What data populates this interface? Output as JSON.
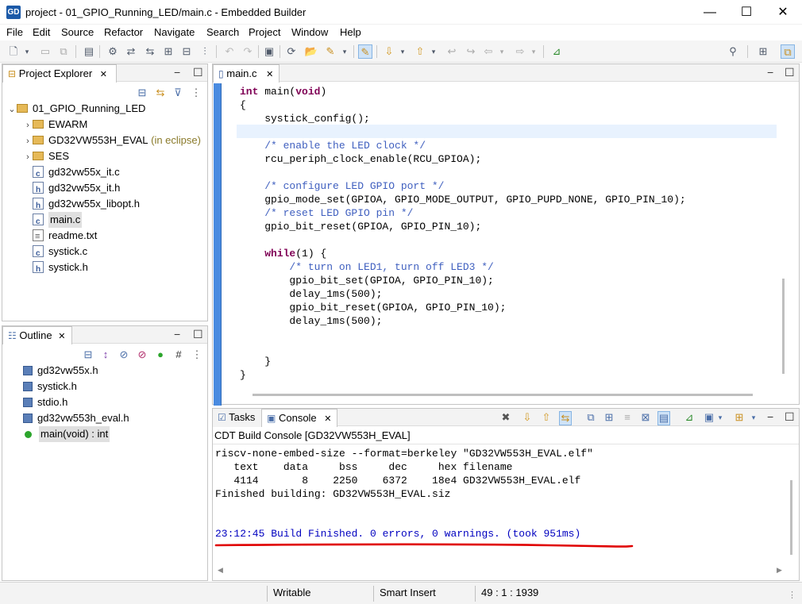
{
  "window": {
    "app_icon_text": "GD",
    "title": "project - 01_GPIO_Running_LED/main.c - Embedded Builder",
    "minimize": "—",
    "maximize": "☐",
    "close": "✕"
  },
  "menu": [
    "File",
    "Edit",
    "Source",
    "Refactor",
    "Navigate",
    "Search",
    "Project",
    "Window",
    "Help"
  ],
  "project_explorer": {
    "title": "Project Explorer",
    "tree": [
      {
        "label": "01_GPIO_Running_LED",
        "type": "project",
        "indent": 0,
        "expanded": true
      },
      {
        "label": "EWARM",
        "type": "folder",
        "indent": 1
      },
      {
        "label": "GD32VW553H_EVAL",
        "suffix": "(in eclipse)",
        "type": "folder",
        "indent": 1
      },
      {
        "label": "SES",
        "type": "folder",
        "indent": 1
      },
      {
        "label": "gd32vw55x_it.c",
        "type": "c",
        "indent": 1
      },
      {
        "label": "gd32vw55x_it.h",
        "type": "h",
        "indent": 1
      },
      {
        "label": "gd32vw55x_libopt.h",
        "type": "h",
        "indent": 1
      },
      {
        "label": "main.c",
        "type": "c",
        "indent": 1,
        "selected": true
      },
      {
        "label": "readme.txt",
        "type": "txt",
        "indent": 1
      },
      {
        "label": "systick.c",
        "type": "c",
        "indent": 1
      },
      {
        "label": "systick.h",
        "type": "h",
        "indent": 1
      }
    ]
  },
  "outline": {
    "title": "Outline",
    "items": [
      {
        "label": "gd32vw55x.h",
        "type": "include"
      },
      {
        "label": "systick.h",
        "type": "include"
      },
      {
        "label": "stdio.h",
        "type": "include"
      },
      {
        "label": "gd32vw553h_eval.h",
        "type": "include"
      },
      {
        "label": "main(void) : int",
        "type": "function",
        "selected": true
      }
    ]
  },
  "editor": {
    "tab": "main.c",
    "lines": [
      [
        {
          "t": "int",
          "c": "kw"
        },
        {
          "t": " main("
        },
        {
          "t": "void",
          "c": "kw"
        },
        {
          "t": ")"
        }
      ],
      [
        {
          "t": "{"
        }
      ],
      [
        {
          "t": "    systick_config();"
        }
      ],
      [
        {
          "t": ""
        }
      ],
      [
        {
          "t": "    /* enable the LED clock */",
          "c": "cm"
        }
      ],
      [
        {
          "t": "    rcu_periph_clock_enable(RCU_GPIOA);"
        }
      ],
      [
        {
          "t": ""
        }
      ],
      [
        {
          "t": "    /* configure LED GPIO port */",
          "c": "cm"
        }
      ],
      [
        {
          "t": "    gpio_mode_set(GPIOA, GPIO_MODE_OUTPUT, GPIO_PUPD_NONE, GPIO_PIN_10);"
        }
      ],
      [
        {
          "t": "    /* reset LED GPIO pin */",
          "c": "cm"
        }
      ],
      [
        {
          "t": "    gpio_bit_reset(GPIOA, GPIO_PIN_10);"
        }
      ],
      [
        {
          "t": ""
        }
      ],
      [
        {
          "t": "    "
        },
        {
          "t": "while",
          "c": "kw"
        },
        {
          "t": "(1) {"
        }
      ],
      [
        {
          "t": "        /* turn on LED1, turn off LED3 */",
          "c": "cm"
        }
      ],
      [
        {
          "t": "        gpio_bit_set(GPIOA, GPIO_PIN_10);"
        }
      ],
      [
        {
          "t": "        delay_1ms(500);"
        }
      ],
      [
        {
          "t": "        gpio_bit_reset(GPIOA, GPIO_PIN_10);"
        }
      ],
      [
        {
          "t": "        delay_1ms(500);"
        }
      ],
      [
        {
          "t": ""
        }
      ],
      [
        {
          "t": ""
        }
      ],
      [
        {
          "t": "    }"
        }
      ],
      [
        {
          "t": "}"
        }
      ]
    ]
  },
  "console": {
    "tabs": [
      "Tasks",
      "Console"
    ],
    "header": "CDT Build Console [GD32VW553H_EVAL]",
    "lines": [
      "riscv-none-embed-size --format=berkeley \"GD32VW553H_EVAL.elf\"",
      "   text    data     bss     dec     hex filename",
      "   4114       8    2250    6372    18e4 GD32VW553H_EVAL.elf",
      "Finished building: GD32VW553H_EVAL.siz",
      "",
      ""
    ],
    "build_result": "23:12:45 Build Finished. 0 errors, 0 warnings. (took 951ms)",
    "build_result_color": "#0000c0",
    "underline_color": "#e00000"
  },
  "status": {
    "writable": "Writable",
    "insert_mode": "Smart Insert",
    "position": "49 : 1 : 1939"
  }
}
